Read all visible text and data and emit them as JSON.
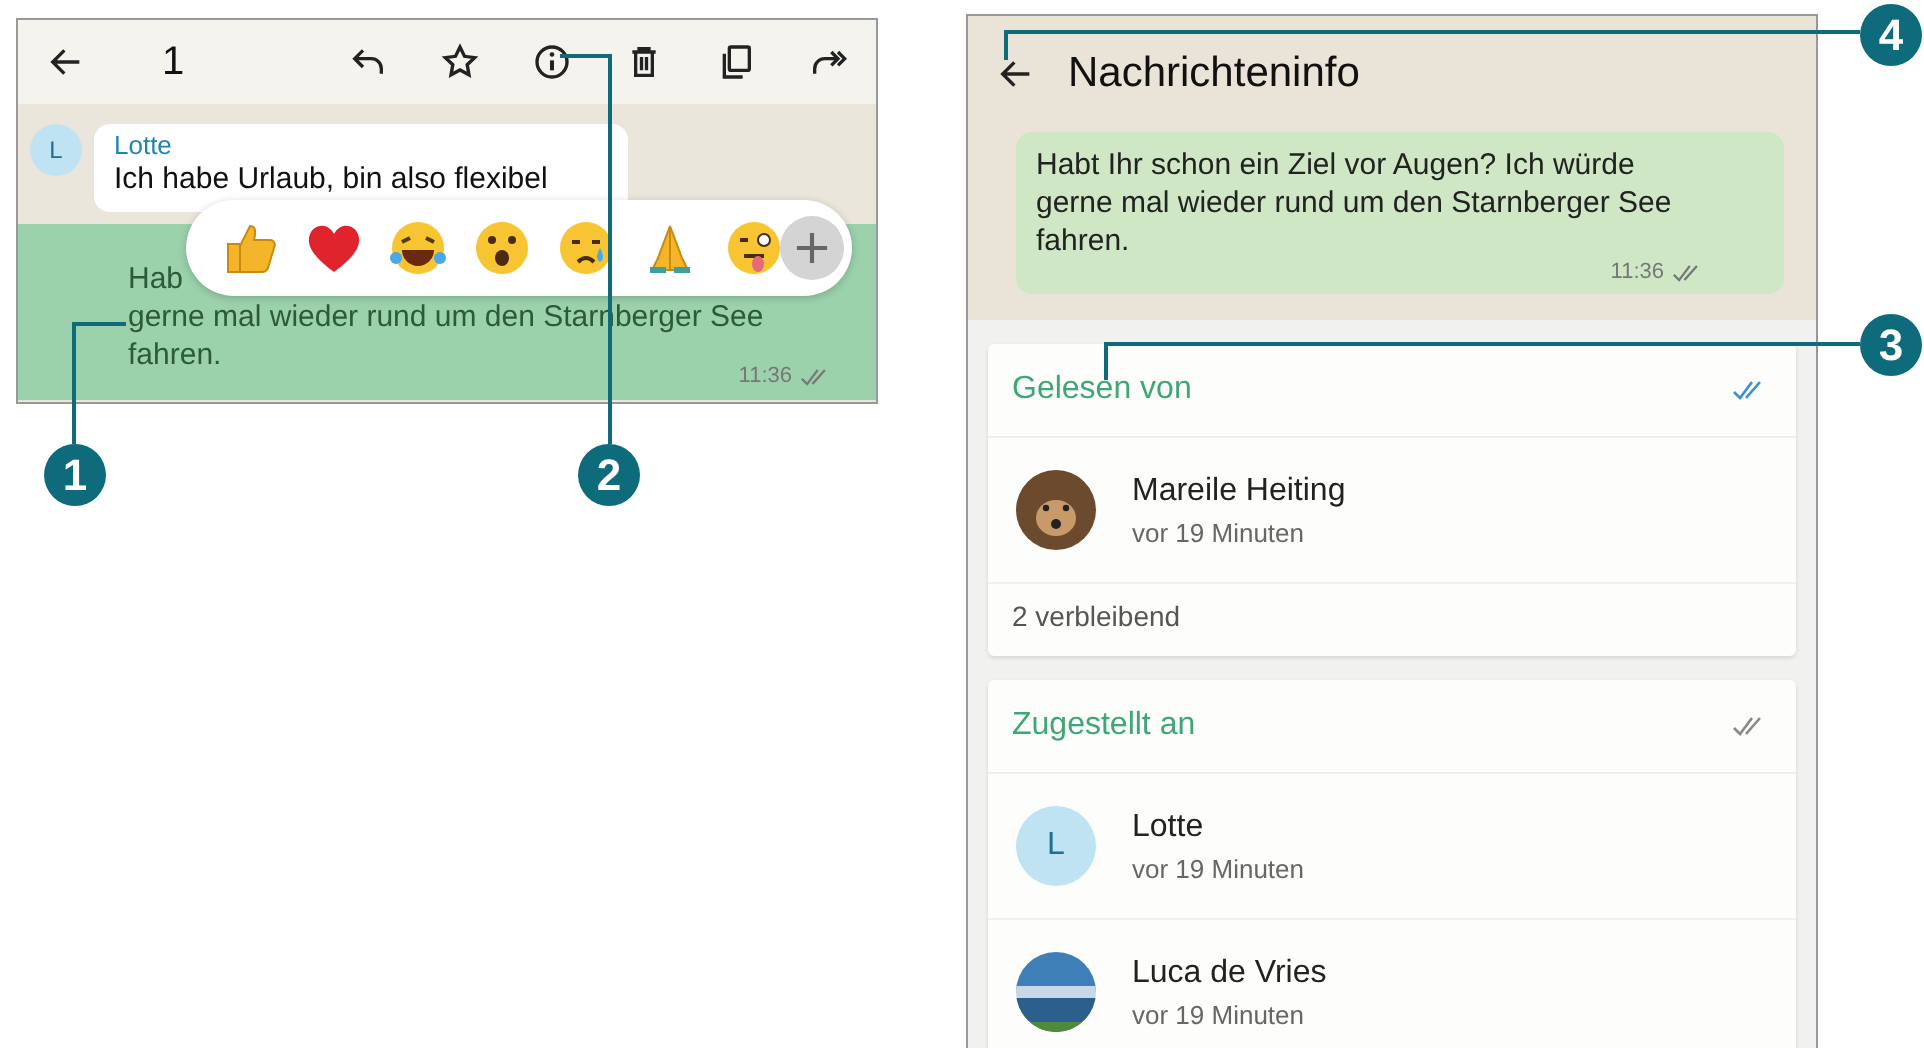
{
  "chat_screen": {
    "selected_count": "1",
    "incoming": {
      "avatar": "L",
      "sender": "Lotte",
      "text": "Ich habe Urlaub, bin also flexibel"
    },
    "outgoing": {
      "lines": [
        "Hab",
        "gerne mal wieder rund um den Starnberger See",
        "fahren."
      ],
      "time": "11:36"
    }
  },
  "info_screen": {
    "title": "Nachrichteninfo",
    "message": {
      "text": "Habt Ihr schon ein Ziel vor Augen? Ich würde gerne mal wieder rund um den Starnberger See fahren.",
      "time": "11:36"
    },
    "sections": [
      {
        "heading": "Gelesen von",
        "read": true,
        "people": [
          {
            "kind": "dog-photo",
            "name": "Mareile Heiting",
            "time": "vor 19 Minuten"
          }
        ],
        "footer": "2 verbleibend"
      },
      {
        "heading": "Zugestellt an",
        "read": false,
        "people": [
          {
            "kind": "letter",
            "avatar": "L",
            "name": "Lotte",
            "time": "vor 19 Minuten"
          },
          {
            "kind": "lake-photo",
            "name": "Luca de Vries",
            "time": "vor 19 Minuten"
          }
        ]
      }
    ]
  },
  "callouts": [
    "1",
    "2",
    "3",
    "4"
  ]
}
